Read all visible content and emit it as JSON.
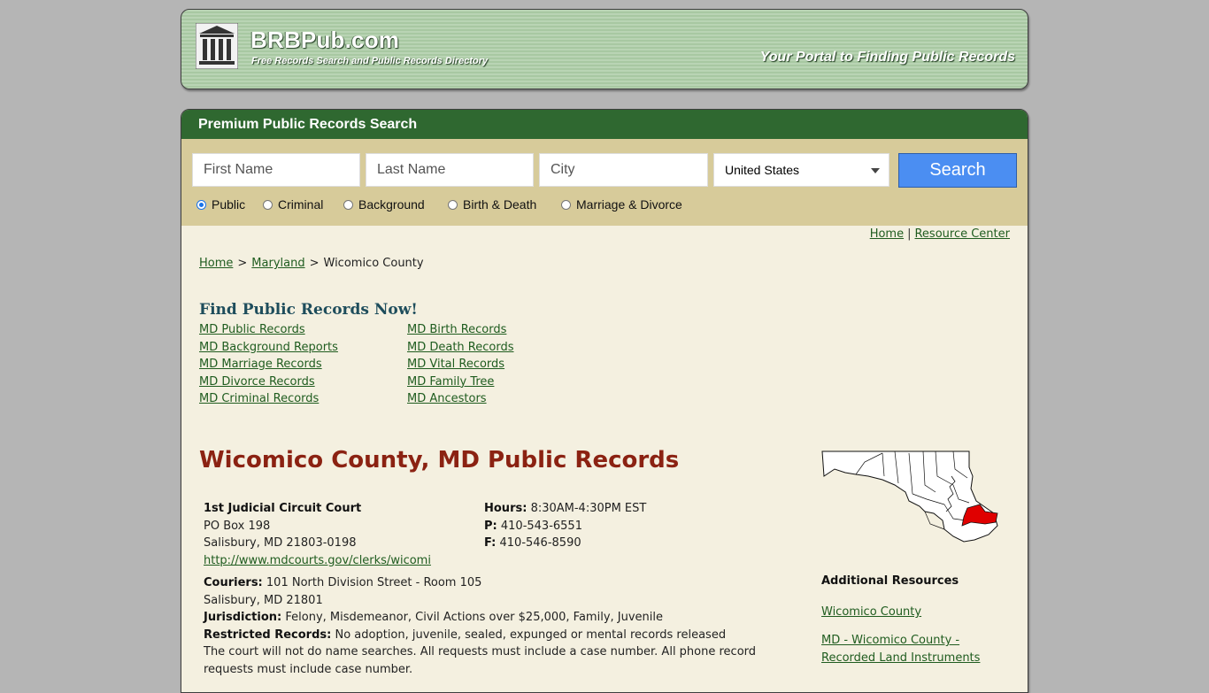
{
  "header": {
    "brand": "BRBPub.com",
    "subtitle": "Free Records Search and Public Records Directory",
    "tagline": "Your Portal to Finding Public Records"
  },
  "search": {
    "heading": "Premium Public Records Search",
    "first_name_placeholder": "First Name",
    "last_name_placeholder": "Last Name",
    "city_placeholder": "City",
    "country_selected": "United States",
    "button": "Search",
    "types": [
      "Public",
      "Criminal",
      "Background",
      "Birth & Death",
      "Marriage & Divorce"
    ],
    "selected_type": "Public"
  },
  "toplinks": {
    "home": "Home",
    "sep": "|",
    "resource": "Resource Center"
  },
  "breadcrumb": {
    "home": "Home",
    "state": "Maryland",
    "current": "Wicomico County",
    "sep": ">"
  },
  "find": {
    "title": "Find Public Records Now!",
    "left": [
      "MD Public Records",
      "MD Background Reports",
      "MD Marriage Records",
      "MD Divorce Records",
      "MD Criminal Records"
    ],
    "right": [
      "MD Birth Records",
      "MD Death Records",
      "MD Vital Records",
      "MD Family Tree",
      "MD Ancestors"
    ]
  },
  "county": {
    "title": "Wicomico County, MD Public Records",
    "court": {
      "name": "1st Judicial Circuit Court",
      "address1": "PO Box 198",
      "address2": "Salisbury, MD 21803-0198",
      "url": "http://www.mdcourts.gov/clerks/wicomi",
      "hours_label": "Hours:",
      "hours": "8:30AM-4:30PM EST",
      "phone_label": "P:",
      "phone": "410-543-6551",
      "fax_label": "F:",
      "fax": "410-546-8590",
      "couriers_label": "Couriers:",
      "couriers": "101 North Division Street - Room 105",
      "couriers2": "Salisbury, MD 21801",
      "jurisdiction_label": "Jurisdiction:",
      "jurisdiction": "Felony, Misdemeanor, Civil Actions over $25,000, Family, Juvenile",
      "restricted_label": "Restricted Records:",
      "restricted": "No adoption, juvenile, sealed, expunged or mental records released",
      "note": "The court will not do name searches. All requests must include a case number. All phone record requests must include case number."
    }
  },
  "additional": {
    "title": "Additional Resources",
    "links": [
      "Wicomico County",
      "MD - Wicomico County - Recorded Land Instruments"
    ]
  },
  "colors": {
    "header_green": "#2f6830",
    "search_bg": "#d7cb9a",
    "content_bg": "#f4f0e0",
    "title_red": "#8b2212",
    "button_blue": "#4b8ef2"
  }
}
